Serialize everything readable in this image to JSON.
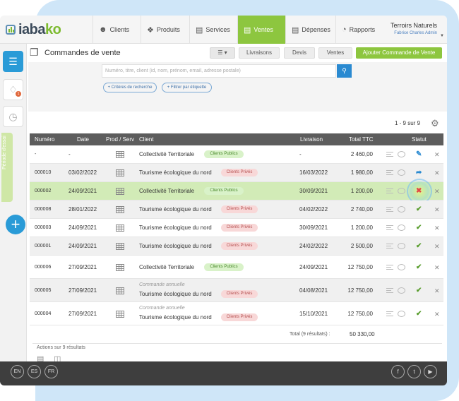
{
  "brand": {
    "logo_text_a": "iaba",
    "logo_text_b": "ko"
  },
  "nav": {
    "items": [
      {
        "label": "Clients",
        "icon": "user-icon"
      },
      {
        "label": "Produits",
        "icon": "tag-icon"
      },
      {
        "label": "Services",
        "icon": "toolbox-icon"
      },
      {
        "label": "Ventes",
        "icon": "invoice-icon",
        "active": true
      },
      {
        "label": "Dépenses",
        "icon": "receipt-icon"
      },
      {
        "label": "Rapports",
        "icon": "chart-icon"
      }
    ],
    "company": "Terroirs Naturels",
    "user": "Fabrice Charles Admin"
  },
  "sidebar": {
    "trial_label": "Période d'essai",
    "notif_count": "1"
  },
  "page": {
    "title": "Commandes de vente",
    "tabs": [
      "Livraisons",
      "Devis",
      "Ventes"
    ],
    "add_button": "Ajouter Commande de Vente",
    "search_placeholder": "Numéro, titre, client (id, nom, prénom, email, adresse postale)",
    "filter_criteria": "+ Critères de recherche",
    "filter_tag": "+ Filtrer par étiquette",
    "pager": "1 - 9 sur 9"
  },
  "table": {
    "headers": [
      "Numéro",
      "Date",
      "Prod / Serv",
      "Client",
      "Livraison",
      "Total TTC",
      "Statut"
    ],
    "rows": [
      {
        "num": "-",
        "date": "-",
        "client": "Collectivité Territoriale",
        "tag": "Clients Publics",
        "tag_type": "pub",
        "delivery": "-",
        "total": "2 460,00",
        "status": "edit"
      },
      {
        "num": "000010",
        "date": "03/02/2022",
        "client": "Tourisme écologique du nord",
        "tag": "Clients Privés",
        "tag_type": "priv",
        "delivery": "16/03/2022",
        "total": "1 980,00",
        "status": "share"
      },
      {
        "num": "000002",
        "date": "24/09/2021",
        "client": "Collectivité Territoriale",
        "tag": "Clients Publics",
        "tag_type": "pub",
        "delivery": "30/09/2021",
        "total": "1 200,00",
        "status": "no"
      },
      {
        "num": "000008",
        "date": "28/01/2022",
        "client": "Tourisme écologique du nord",
        "tag": "Clients Privés",
        "tag_type": "priv",
        "delivery": "04/02/2022",
        "total": "2 740,00",
        "status": "ok"
      },
      {
        "num": "000003",
        "date": "24/09/2021",
        "client": "Tourisme écologique du nord",
        "tag": "Clients Privés",
        "tag_type": "priv",
        "delivery": "30/09/2021",
        "total": "1 200,00",
        "status": "ok"
      },
      {
        "num": "000001",
        "date": "24/09/2021",
        "client": "Tourisme écologique du nord",
        "tag": "Clients Privés",
        "tag_type": "priv",
        "delivery": "24/02/2022",
        "total": "2 500,00",
        "status": "ok"
      },
      {
        "num": "000006",
        "date": "27/09/2021",
        "client": "Collectivité Territoriale",
        "tag": "Clients Publics",
        "tag_type": "pub",
        "delivery": "24/09/2021",
        "total": "12 750,00",
        "status": "ok"
      },
      {
        "num": "000005",
        "date": "27/09/2021",
        "subtitle": "Commande annuelle",
        "client": "Tourisme écologique du nord",
        "tag": "Clients Privés",
        "tag_type": "priv",
        "delivery": "04/08/2021",
        "total": "12 750,00",
        "status": "ok"
      },
      {
        "num": "000004",
        "date": "27/09/2021",
        "subtitle": "Commande annuelle",
        "client": "Tourisme écologique du nord",
        "tag": "Clients Privés",
        "tag_type": "priv",
        "delivery": "15/10/2021",
        "total": "12 750,00",
        "status": "ok"
      }
    ],
    "total_label": "Total (9 résultats) :",
    "total_value": "50 330,00"
  },
  "actions": {
    "label": "Actions sur 9 résultats"
  },
  "footer": {
    "langs": [
      "EN",
      "ES",
      "FR"
    ],
    "social": [
      "facebook-icon",
      "twitter-icon",
      "youtube-icon"
    ]
  },
  "colors": {
    "accent": "#8dc63f",
    "primary": "#2a9bd7",
    "header": "#5d5d5d",
    "footer": "#3e3e3e"
  }
}
